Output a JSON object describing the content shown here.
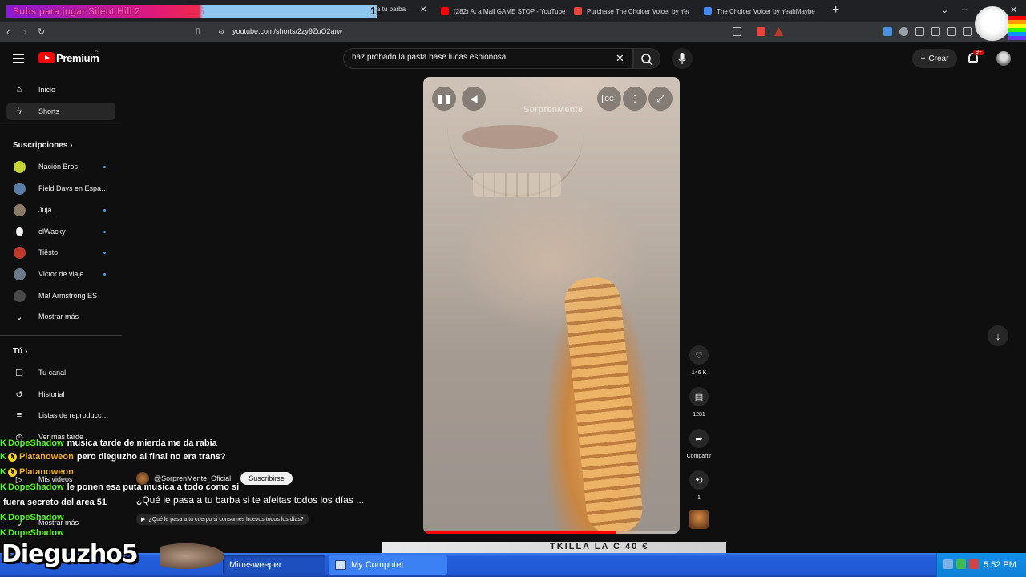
{
  "overlay": {
    "goal_text": "Subs para jugar Silent Hill 2",
    "goal_current": "5",
    "goal_target": "10"
  },
  "browser": {
    "partial_tab_label": "a tu barba",
    "tabs": [
      {
        "label": "(282) At a Mall GAME STOP - YouTube",
        "favicon_color": "#ff0000"
      },
      {
        "label": "Purchase The Choicer Voicer by YeahMaybe",
        "favicon_color": "#e8453c"
      },
      {
        "label": "The Choicer Voicer by YeahMaybe",
        "favicon_color": "#4285f4"
      }
    ],
    "url": "youtube.com/shorts/2zy9ZuO2arw"
  },
  "header": {
    "logo_label": "Premium",
    "logo_region": "CL",
    "search_value": "haz probado la pasta base lucas espionosa",
    "create_label": "Crear",
    "notif_badge": "9+"
  },
  "sidebar": {
    "nav": [
      {
        "label": "Inicio",
        "icon": "home-icon"
      },
      {
        "label": "Shorts",
        "icon": "shorts-icon"
      }
    ],
    "subscriptions_heading": "Suscripciones",
    "subscriptions": [
      {
        "label": "Nación Bros",
        "color": "#c6d433",
        "dot": true
      },
      {
        "label": "Field Days en Espa…",
        "color": "#5a7ea6",
        "dot": false
      },
      {
        "label": "Juja",
        "color": "#8a7a6a",
        "dot": true
      },
      {
        "label": "elWacky",
        "color": "#f1f1f1",
        "dot": true
      },
      {
        "label": "Tiësto",
        "color": "#c0392b",
        "dot": true
      },
      {
        "label": "Victor de viaje",
        "color": "#6b7b8c",
        "dot": true
      },
      {
        "label": "Mat Armstrong ES",
        "color": "#4a4a4a",
        "dot": false
      }
    ],
    "show_more": "Mostrar más",
    "you_heading": "Tú",
    "you_items": [
      {
        "label": "Tu canal",
        "icon": "channel-icon"
      },
      {
        "label": "Historial",
        "icon": "history-icon"
      },
      {
        "label": "Listas de reproducc…",
        "icon": "playlist-icon"
      },
      {
        "label": "Ver más tarde",
        "icon": "clock-icon"
      },
      {
        "label": "Mis videos",
        "icon": "video-icon"
      },
      {
        "label": "Mostrar más",
        "icon": "chevron-down-icon"
      }
    ]
  },
  "player": {
    "watermark": "SorprenMente",
    "progress": 0.75
  },
  "actions": {
    "likes": "146 K",
    "comments": "1281",
    "share_label": "Compartir",
    "remix_count": "1"
  },
  "video": {
    "channel": "@SorprenMente_Oficial",
    "subscribe_label": "Suscribirse",
    "title": "¿Qué le pasa a tu barba si te afeitas todos los días ...",
    "suggestion": "¿Qué le pasa a tu cuerpo si consumes huevos todos los días?"
  },
  "chat": [
    {
      "user": "DopeShadow",
      "message": "musica tarde de mierda me da rabia",
      "gold": false,
      "badge": false
    },
    {
      "user": "Platanoweon",
      "message": "pero dieguzho al final no era trans?",
      "gold": true,
      "badge": true
    },
    {
      "user": "Platanoweon",
      "message": "",
      "gold": true,
      "badge": true
    },
    {
      "user": "DopeShadow",
      "message": "le ponen esa puta musica a todo como si",
      "gold": false,
      "badge": false
    },
    {
      "user": "",
      "message": "fuera secreto del area 51",
      "gold": false,
      "badge": false
    },
    {
      "user": "DopeShadow",
      "message": "",
      "gold": false,
      "badge": false
    },
    {
      "user": "DopeShadow",
      "message": "",
      "gold": false,
      "badge": false
    }
  ],
  "streamer": {
    "name": "Dieguzho5"
  },
  "taskbar": {
    "items": [
      {
        "label": "Minesweeper",
        "active": true
      },
      {
        "label": "My Computer",
        "active": false
      }
    ],
    "clock": "5:52 PM",
    "bottom_strip_text": "TKILLA LA C  40 €"
  }
}
